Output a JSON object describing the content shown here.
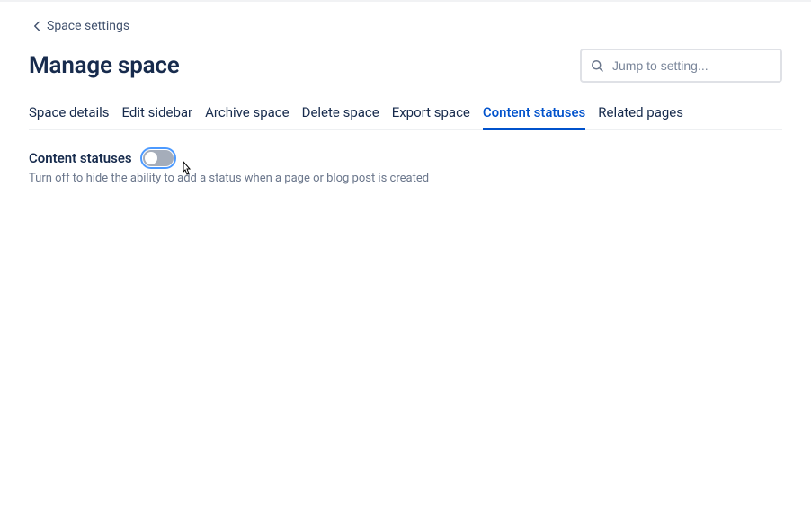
{
  "breadcrumb": {
    "label": "Space settings"
  },
  "header": {
    "title": "Manage space"
  },
  "search": {
    "placeholder": "Jump to setting..."
  },
  "tabs": [
    {
      "label": "Space details",
      "active": false
    },
    {
      "label": "Edit sidebar",
      "active": false
    },
    {
      "label": "Archive space",
      "active": false
    },
    {
      "label": "Delete space",
      "active": false
    },
    {
      "label": "Export space",
      "active": false
    },
    {
      "label": "Content statuses",
      "active": true
    },
    {
      "label": "Related pages",
      "active": false
    }
  ],
  "section": {
    "label": "Content statuses",
    "toggle_on": false,
    "description": "Turn off to hide the ability to add a status when a page or blog post is created"
  }
}
